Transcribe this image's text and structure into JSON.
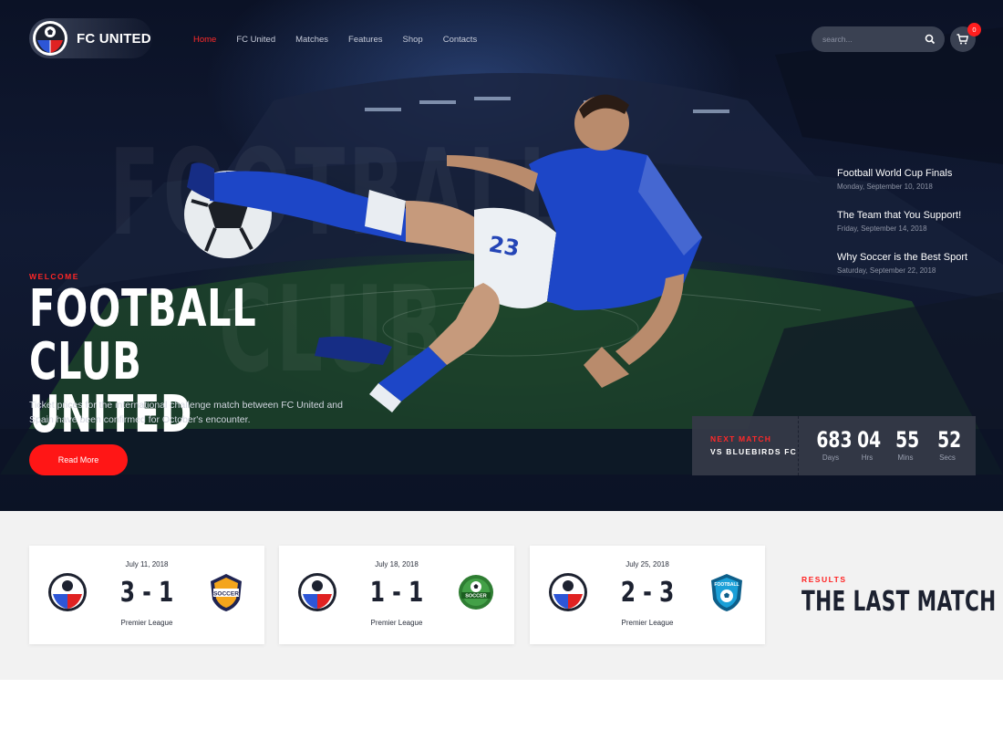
{
  "brand": {
    "name": "FC UNITED"
  },
  "nav": {
    "items": [
      {
        "label": "Home",
        "active": true
      },
      {
        "label": "FC United",
        "active": false
      },
      {
        "label": "Matches",
        "active": false
      },
      {
        "label": "Features",
        "active": false
      },
      {
        "label": "Shop",
        "active": false
      },
      {
        "label": "Contacts",
        "active": false
      }
    ]
  },
  "search": {
    "placeholder": "search..."
  },
  "cart": {
    "count": "0"
  },
  "hero": {
    "background_words": [
      "FOOTBALL",
      "CLUB"
    ],
    "eyebrow": "WELCOME",
    "title_line1": "FOOTBALL CLUB",
    "title_line2": "UNITED",
    "description": "Ticket prices for the international challenge match between FC United and Spain have been confirmed for October's encounter.",
    "button_label": "Read More",
    "player_number": "23"
  },
  "news": [
    {
      "title": "Football World Cup Finals",
      "date": "Monday, September 10, 2018"
    },
    {
      "title": "The Team that You Support!",
      "date": "Friday, September 14, 2018"
    },
    {
      "title": "Why Soccer is the Best Sport",
      "date": "Saturday, September 22, 2018"
    }
  ],
  "countdown": {
    "label": "NEXT MATCH",
    "opponent": "VS BLUEBIRDS FC",
    "days": "683",
    "days_label": "Days",
    "hours": "04",
    "hours_label": "Hrs",
    "mins": "55",
    "mins_label": "Mins",
    "secs": "52",
    "secs_label": "Secs"
  },
  "results": {
    "eyebrow": "RESULTS",
    "title": "THE LAST MATCH",
    "matches": [
      {
        "date": "July 11, 2018",
        "score": "3 - 1",
        "league": "Premier League",
        "away_badge_text": "SOCCER"
      },
      {
        "date": "July 18, 2018",
        "score": "1 - 1",
        "league": "Premier League",
        "away_badge_text": "SOCCER"
      },
      {
        "date": "July 25, 2018",
        "score": "2 - 3",
        "league": "Premier League",
        "away_badge_text": "FOOTBALL"
      }
    ]
  },
  "colors": {
    "accent": "#ff1a1a",
    "hero_bg": "#0d1427",
    "jersey_blue": "#1d46c7",
    "panel": "#353a48",
    "section_bg": "#f2f2f2"
  }
}
